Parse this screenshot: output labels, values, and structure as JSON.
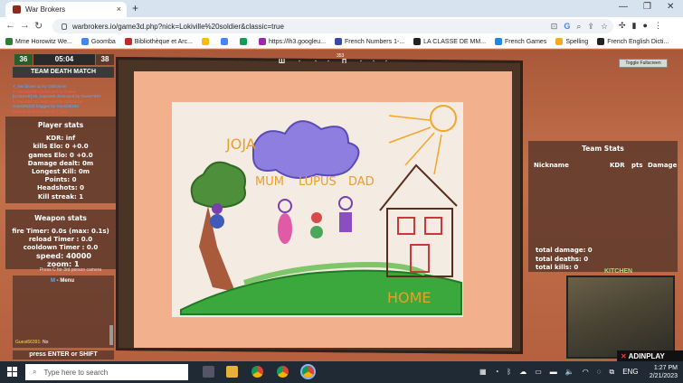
{
  "browser": {
    "tab_title": "War Brokers",
    "tab_close": "×",
    "new_tab": "+",
    "url": "warbrokers.io/game3d.php?nick=Lokiville%20soldier&classic=true",
    "bookmarks": [
      {
        "label": "Mme Horowitz We...",
        "color": "#2e7d32"
      },
      {
        "label": "Goomba",
        "color": "#4285f4"
      },
      {
        "label": "Bibliothèque et Arc...",
        "color": "#c62828"
      },
      {
        "label": "",
        "color": "#fbbc05"
      },
      {
        "label": "",
        "color": "#4285f4"
      },
      {
        "label": "",
        "color": "#0f9d58"
      },
      {
        "label": "https://lh3.googleu...",
        "color": "#9c27b0"
      },
      {
        "label": "French Numbers 1-...",
        "color": "#3949ab"
      },
      {
        "label": "LA CLASSE DE MM...",
        "color": "#222222"
      },
      {
        "label": "French Games",
        "color": "#1e88e5"
      },
      {
        "label": "Spelling",
        "color": "#f9a825"
      },
      {
        "label": "French English Dicti...",
        "color": "#222222"
      }
    ]
  },
  "game": {
    "score_left": "36",
    "timer": "05:04",
    "score_right": "38",
    "mode": "TEAM DEATH MATCH",
    "compass_degree": "353",
    "toggle_fullscreen": "Toggle Fullscreen",
    "killfeed": [
      "Y_Nut blown up by OldGamer",
      "K Guest59423 destroyed by Rafael",
      "[CASSAR] Mr_bopos65 destroyed by Guest7597",
      "K Guest39735 destroyed by OldGamer",
      "Guest#6233 fragged by Guest38189",
      "OldGamer blown up by Y_Nut"
    ],
    "player_stats": {
      "title": "Player stats",
      "lines": [
        "KDR: inf",
        "kills Elo: 0 +0.0",
        "games Elo: 0 +0.0",
        "Damage dealt: 0m",
        "Longest Kill: 0m",
        "Points: 0",
        "Headshots: 0",
        "Kill streak: 1"
      ]
    },
    "weapon_stats": {
      "title": "Weapon stats",
      "lines": [
        "fire Timer: 0.0s (max: 0.1s)",
        "reload Timer : 0.0",
        "cooldown Timer : 0.0"
      ]
    },
    "speed": "speed: 40000",
    "zoom": "zoom: 1",
    "camera_hint": "Press C for 3rd person camera",
    "chat": {
      "menu_key": "M",
      "menu_label": " - Menu",
      "message_user": "Guest66391:",
      "message_text": " No"
    },
    "enter_hint": "press ENTER or SHIFT",
    "team_stats": {
      "title": "Team Stats",
      "headers": [
        "Nickname",
        "KDR",
        "pts",
        "Damage"
      ],
      "totals": [
        "total damage: 0",
        "total deaths: 0",
        "total kills: 0"
      ]
    },
    "minimap_label": "KITCHEN",
    "ad_label": "ADINPLAY",
    "painting": {
      "labels": [
        "JOJA",
        "MUM",
        "LUPUS",
        "DAD",
        "HOME"
      ]
    }
  },
  "taskbar": {
    "search_placeholder": "Type here to search",
    "language": "ENG",
    "time": "1:27 PM",
    "date": "2/21/2023"
  }
}
